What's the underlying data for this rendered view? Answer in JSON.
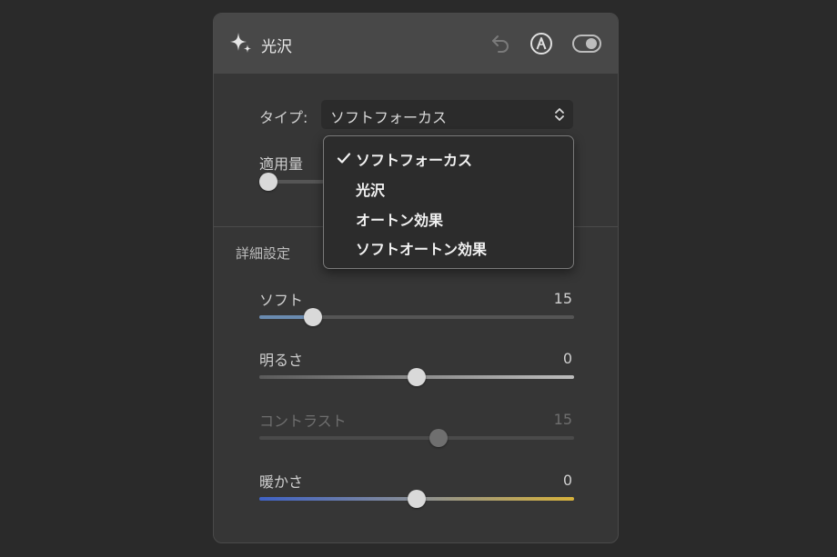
{
  "header": {
    "title": "光沢",
    "icons": [
      "sparkle-icon",
      "undo-icon",
      "auto-pen-icon",
      "toggle-icon"
    ]
  },
  "type_row": {
    "label": "タイプ:",
    "selected": "ソフトフォーカス"
  },
  "amount_row": {
    "label": "適用量",
    "value_fraction": 0.03
  },
  "dropdown": {
    "options": [
      "ソフトフォーカス",
      "光沢",
      "オートン効果",
      "ソフトオートン効果"
    ],
    "checked_index": 0
  },
  "details": {
    "section_title": "詳細設定",
    "sliders": [
      {
        "label": "ソフト",
        "value": "15",
        "fraction": 0.17,
        "enabled": true,
        "fill": "blue"
      },
      {
        "label": "明るさ",
        "value": "0",
        "fraction": 0.5,
        "enabled": true,
        "fill": "gray"
      },
      {
        "label": "コントラスト",
        "value": "15",
        "fraction": 0.57,
        "enabled": false,
        "fill": "none"
      },
      {
        "label": "暖かさ",
        "value": "0",
        "fraction": 0.5,
        "enabled": true,
        "fill": "warm"
      }
    ]
  },
  "colors": {
    "background": "#2a2a2a",
    "panel": "#363636",
    "header": "#484848",
    "soft_fill": "#6a8bb0",
    "warm_blue": "#3f62c6",
    "warm_yellow": "#d7b23b"
  }
}
